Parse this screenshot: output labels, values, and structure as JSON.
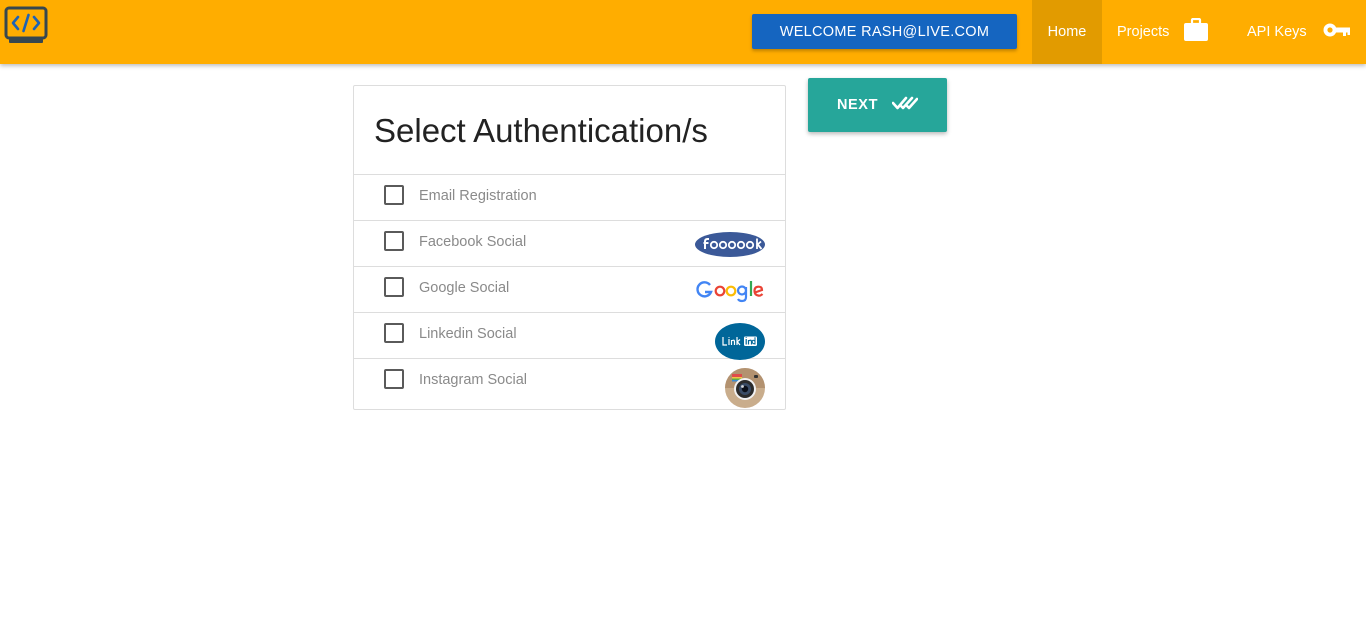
{
  "navbar": {
    "logo_icon": "code-monitor-icon",
    "welcome_label": "WELCOME RASH@LIVE.COM",
    "home_label": "Home",
    "projects_label": "Projects",
    "projects_icon": "briefcase-icon",
    "api_keys_label": "API Keys",
    "api_keys_icon": "key-icon",
    "colors": {
      "bar": "#ffad00",
      "active": "#e29b00",
      "welcome_button": "#1565c0"
    }
  },
  "auth_card": {
    "title": "Select Authentication/s",
    "options": [
      {
        "label": "Email Registration",
        "checked": false,
        "icon": ""
      },
      {
        "label": "Facebook Social",
        "checked": false,
        "icon": "facebook-logo-icon"
      },
      {
        "label": "Google Social",
        "checked": false,
        "icon": "google-logo-icon"
      },
      {
        "label": "Linkedin Social",
        "checked": false,
        "icon": "linkedin-logo-icon"
      },
      {
        "label": "Instagram Social",
        "checked": false,
        "icon": "instagram-logo-icon"
      }
    ]
  },
  "next_button": {
    "label": "NEXT",
    "icon": "double-check-icon",
    "color": "#26a69a"
  }
}
